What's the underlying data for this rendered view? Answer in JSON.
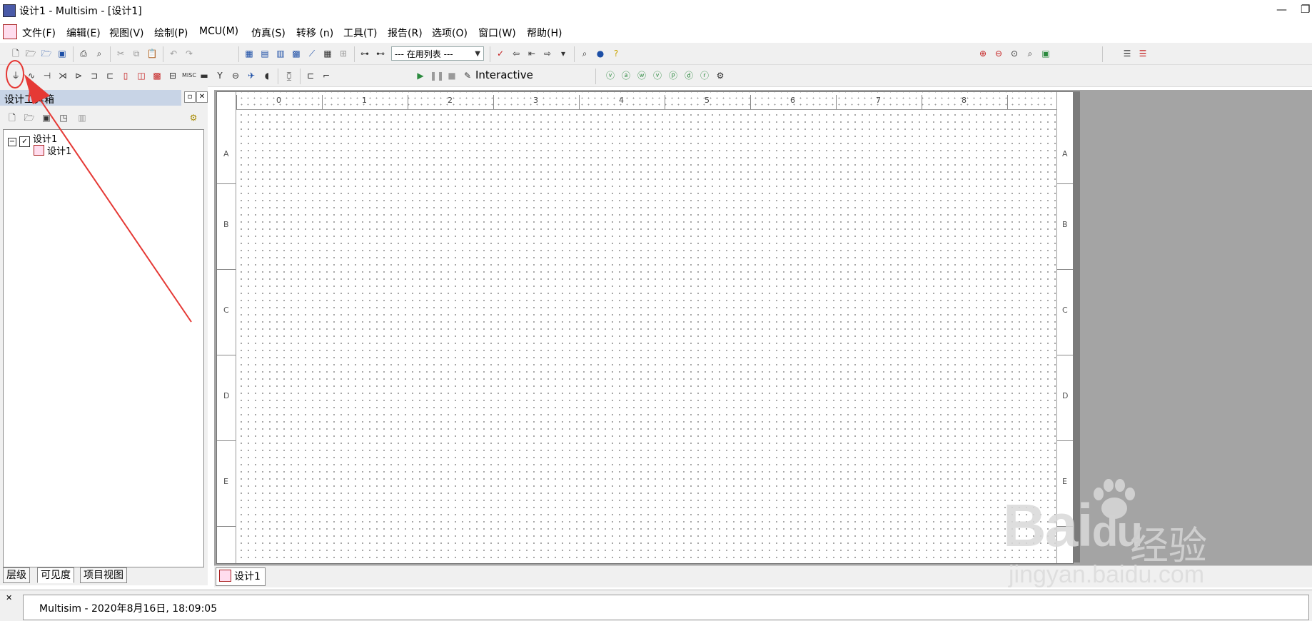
{
  "window": {
    "title": "设计1 - Multisim - [设计1]",
    "minimize_glyph": "—",
    "restore_glyph": "❐"
  },
  "menu": {
    "items": [
      "文件(F)",
      "编辑(E)",
      "视图(V)",
      "绘制(P)",
      "MCU(M)",
      "仿真(S)",
      "转移 (n)",
      "工具(T)",
      "报告(R)",
      "选项(O)",
      "窗口(W)",
      "帮助(H)"
    ]
  },
  "toolbar": {
    "in_use_list": "--- 在用列表 ---",
    "sim_mode": "Interactive"
  },
  "design_toolbox": {
    "title": "设计工具箱",
    "tree": {
      "root": "设计1",
      "child": "设计1"
    },
    "tabs": [
      "层级",
      "可见度",
      "项目视图"
    ]
  },
  "sheet": {
    "columns": [
      "0",
      "1",
      "2",
      "3",
      "4",
      "5",
      "6",
      "7",
      "8"
    ],
    "rows": [
      "A",
      "B",
      "C",
      "D",
      "E"
    ]
  },
  "doc_tab": {
    "label": "设计1"
  },
  "status": {
    "message": "Multisim  -  2020年8月16日, 18:09:05"
  },
  "watermark": {
    "brand": "Bai",
    "brand2": "du",
    "product": "经验",
    "url": "jingyan.baidu.com"
  },
  "colors": {
    "annotation": "#e53935",
    "panel_header": "#c8d4e6"
  }
}
